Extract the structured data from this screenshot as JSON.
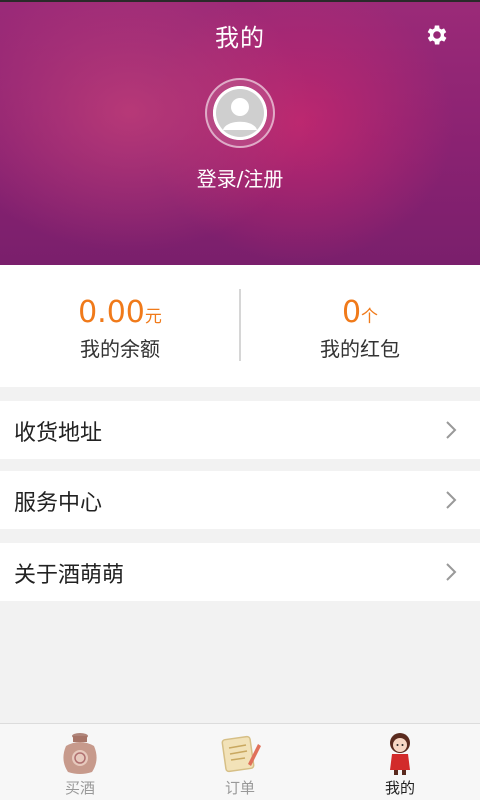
{
  "header": {
    "title": "我的",
    "login_text": "登录/注册",
    "settings_icon": "gear-icon",
    "avatar_icon": "default-avatar-icon"
  },
  "stats": {
    "balance": {
      "value": "0.00",
      "unit": "元",
      "label": "我的余额"
    },
    "red_packets": {
      "value": "0",
      "unit": "个",
      "label": "我的红包"
    }
  },
  "menu": [
    {
      "label": "收货地址",
      "icon": "chevron-right-icon"
    },
    {
      "label": "服务中心",
      "icon": "chevron-right-icon"
    },
    {
      "label": "关于酒萌萌",
      "icon": "chevron-right-icon"
    }
  ],
  "tabbar": [
    {
      "label": "买酒",
      "icon": "wine-jar-icon",
      "active": false
    },
    {
      "label": "订单",
      "icon": "order-scroll-icon",
      "active": false
    },
    {
      "label": "我的",
      "icon": "mascot-girl-icon",
      "active": true
    }
  ],
  "colors": {
    "header_bg": "#8a2272",
    "accent_orange": "#f07a1a",
    "page_bg": "#f2f2f2"
  }
}
